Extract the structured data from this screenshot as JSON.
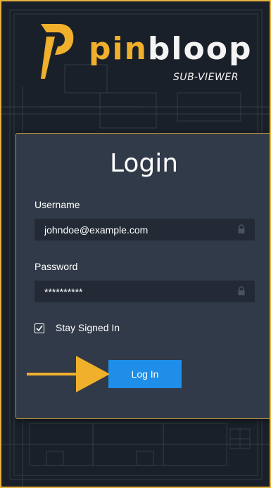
{
  "brand": {
    "name_part1": "pin",
    "name_part2": "bloop",
    "subtitle": "SUB-VIEWER"
  },
  "login_form": {
    "title": "Login",
    "username_label": "Username",
    "username_value": "johndoe@example.com",
    "password_label": "Password",
    "password_value": "**********",
    "stay_signed_in_label": "Stay Signed In",
    "stay_signed_in_checked": true,
    "submit_label": "Log In"
  },
  "icons": {
    "username_field_icon": "lock-icon",
    "password_field_icon": "lock-icon",
    "annotation_arrow": "arrow-right-icon"
  },
  "colors": {
    "accent": "#f0b02c",
    "button": "#1e8ee8",
    "card": "#313a48",
    "field": "#232a35",
    "background": "#1a2029"
  }
}
